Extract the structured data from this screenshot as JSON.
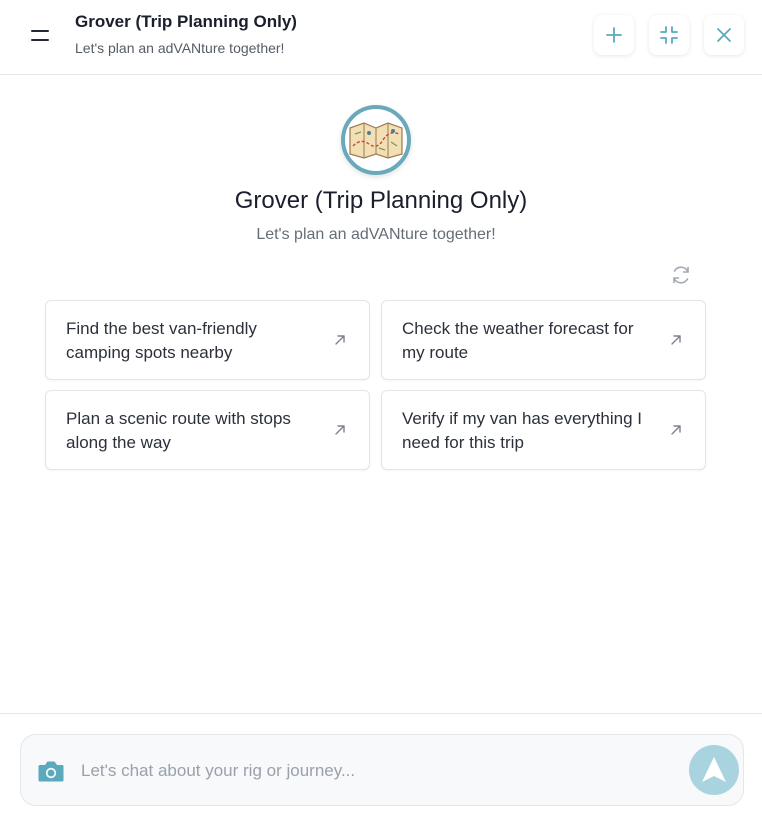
{
  "header": {
    "title": "Grover (Trip Planning Only)",
    "subtitle": "Let's plan an adVANture together!",
    "menu_icon": "hamburger-menu-icon",
    "actions": [
      "plus-icon",
      "collapse-icon",
      "close-icon"
    ]
  },
  "hero": {
    "avatar_icon": "folded-map-icon",
    "title": "Grover (Trip Planning Only)",
    "subtitle": "Let's plan an adVANture together!",
    "refresh_icon": "refresh-icon"
  },
  "suggestions": [
    {
      "text": "Find the best van-friendly camping spots nearby"
    },
    {
      "text": "Check the weather forecast for my route"
    },
    {
      "text": "Plan a scenic route with stops along the way"
    },
    {
      "text": "Verify if my van has everything I need for this trip"
    }
  ],
  "composer": {
    "placeholder": "Let's chat about your rig or journey...",
    "value": "",
    "camera_icon": "camera-icon",
    "send_icon": "send-arrow-icon"
  },
  "colors": {
    "accent": "#5aa9bd",
    "avatar_ring": "#6aa9bb",
    "send_button": "#a9d3df"
  }
}
